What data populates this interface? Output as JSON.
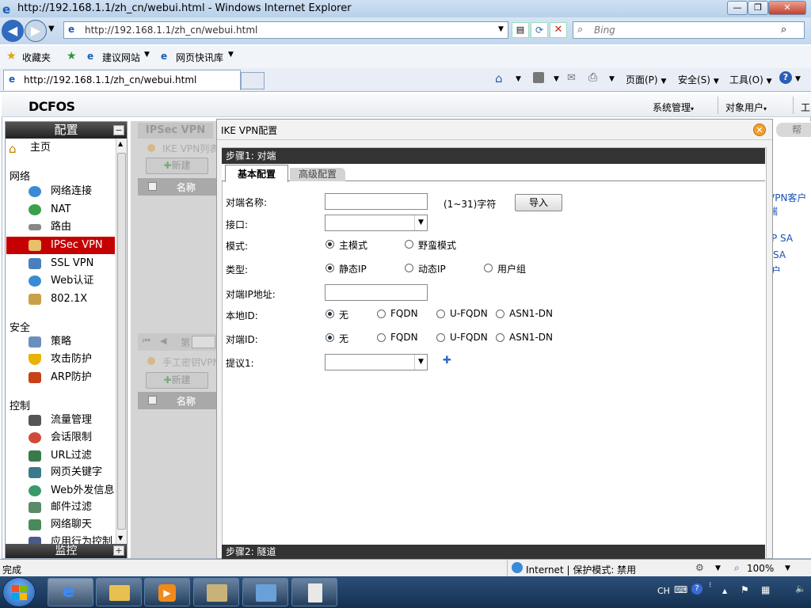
{
  "window": {
    "title": "http://192.168.1.1/zh_cn/webui.html - Windows Internet Explorer"
  },
  "browser": {
    "address": "http://192.168.1.1/zh_cn/webui.html",
    "search_placeholder": "Bing",
    "favorites_label": "收藏夹",
    "fav_links": [
      "建议网站",
      "网页快讯库"
    ],
    "tab_title": "http://192.168.1.1/zh_cn/webui.html",
    "cmd": {
      "page": "页面(P)",
      "safety": "安全(S)",
      "tools": "工具(O)"
    }
  },
  "app": {
    "logo": "DCFOS",
    "top_menu": [
      "系统管理",
      "对象用户",
      "工"
    ],
    "help": "帮"
  },
  "sidebar": {
    "header": "配置",
    "home": "主页",
    "sections": [
      {
        "title": "网络",
        "items": [
          "网络连接",
          "NAT",
          "路由",
          "IPSec VPN",
          "SSL VPN",
          "Web认证",
          "802.1X"
        ]
      },
      {
        "title": "安全",
        "items": [
          "策略",
          "攻击防护",
          "ARP防护"
        ]
      },
      {
        "title": "控制",
        "items": [
          "流量管理",
          "会话限制",
          "URL过滤",
          "网页关键字",
          "Web外发信息",
          "邮件过滤",
          "网络聊天",
          "应用行为控制"
        ]
      }
    ],
    "active": "IPSec VPN",
    "footer": "监控"
  },
  "background_panel": {
    "tab": "IPSec VPN",
    "ike_list": "IKE VPN列表",
    "manual_list": "手工密钥VPN",
    "new_label": "新建",
    "col_name": "名称",
    "pager_prefix": "第",
    "right_links": [
      "VPN客户端",
      "P SA",
      "SA",
      "户"
    ]
  },
  "dialog": {
    "title": "IKE VPN配置",
    "step1": "步骤1: 对端",
    "step2": "步骤2: 隧道",
    "tabs": [
      "基本配置",
      "高级配置"
    ],
    "fields": {
      "peer_name_label": "对端名称:",
      "peer_name_hint": "(1~31)字符",
      "import_label": "导入",
      "interface_label": "接口:",
      "mode_label": "模式:",
      "mode_options": [
        "主模式",
        "野蛮模式"
      ],
      "type_label": "类型:",
      "type_options": [
        "静态IP",
        "动态IP",
        "用户组"
      ],
      "peer_ip_label": "对端IP地址:",
      "local_id_label": "本地ID:",
      "id_options": [
        "无",
        "FQDN",
        "U-FQDN",
        "ASN1-DN"
      ],
      "peer_id_label": "对端ID:",
      "proposal_label": "提议1:"
    }
  },
  "status": {
    "left": "完成",
    "zone": "Internet | 保护模式: 禁用",
    "zoom": "100%"
  },
  "taskbar": {
    "lang": "CH"
  }
}
